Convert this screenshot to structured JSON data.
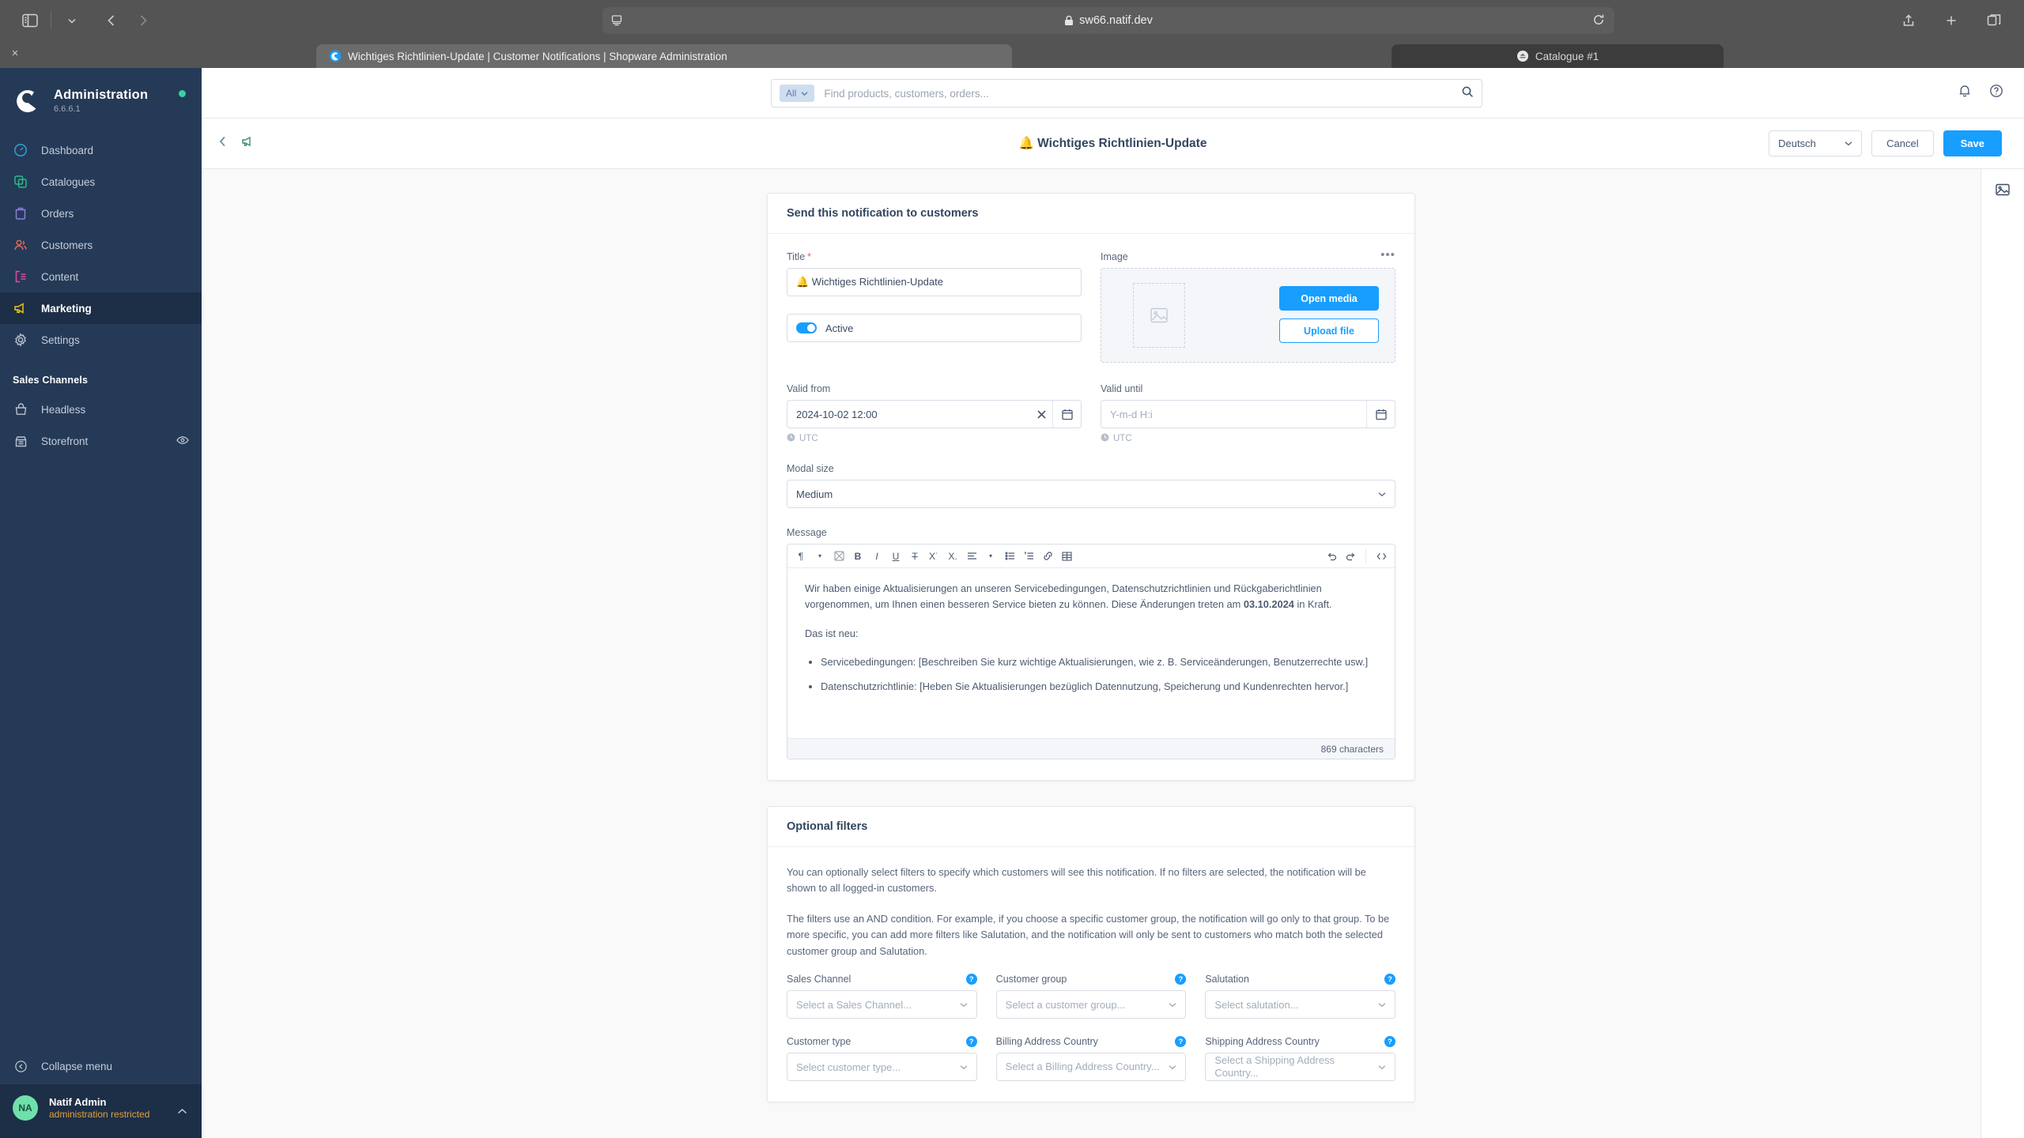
{
  "browser": {
    "url": "sw66.natif.dev",
    "lock_icon": "lock-icon",
    "reload_icon": "reload-icon",
    "back_icon": "back-arrow-icon",
    "forward_icon": "forward-arrow-icon",
    "sidebar_icon": "sidebar-toggle-icon",
    "screencast_icon": "screencast-icon",
    "share_icon": "share-icon",
    "new_tab_icon": "plus-icon",
    "tabs_overview_icon": "tabs-overview-icon",
    "close_all_label": "×",
    "tabs": [
      {
        "title": "Wichtiges Richtlinien-Update | Customer Notifications | Shopware Administration",
        "favicon": "shopware-favicon",
        "emoji": "🔔",
        "active": true
      },
      {
        "title": "Catalogue #1",
        "favicon": "catalogue-favicon",
        "active": false
      }
    ]
  },
  "sidebar": {
    "title": "Administration",
    "version": "6.6.6.1",
    "status_dot_color": "#37d39b",
    "items": [
      {
        "label": "Dashboard",
        "icon": "dashboard-icon",
        "color": "#31a0d4",
        "active": false
      },
      {
        "label": "Catalogues",
        "icon": "catalogues-icon",
        "color": "#2bb98a",
        "active": false
      },
      {
        "label": "Orders",
        "icon": "orders-icon",
        "color": "#8e7ee0",
        "active": false
      },
      {
        "label": "Customers",
        "icon": "customers-icon",
        "color": "#e06c5a",
        "active": false
      },
      {
        "label": "Content",
        "icon": "content-icon",
        "color": "#e34ba0",
        "active": false
      },
      {
        "label": "Marketing",
        "icon": "marketing-icon",
        "color": "#e8c51f",
        "active": true
      },
      {
        "label": "Settings",
        "icon": "settings-gear-icon",
        "color": "#b8c1cf",
        "active": false
      }
    ],
    "sales_channels_title": "Sales Channels",
    "sales_channels": [
      {
        "label": "Headless",
        "icon": "headless-icon",
        "has_eye": false
      },
      {
        "label": "Storefront",
        "icon": "storefront-icon",
        "has_eye": true
      }
    ],
    "collapse_label": "Collapse menu",
    "collapse_icon": "collapse-arrow-icon",
    "user": {
      "initials": "NA",
      "name": "Natif Admin",
      "role": "administration restricted",
      "caret_icon": "chevron-up-icon"
    }
  },
  "topbar": {
    "search_scope": "All",
    "search_scope_caret": "chevron-down-icon",
    "search_placeholder": "Find products, customers, orders...",
    "search_value": "",
    "search_icon": "search-icon",
    "notification_icon": "bell-icon",
    "help_icon": "help-circle-icon"
  },
  "page_header": {
    "back_icon": "chevron-left-icon",
    "notification_icon": "notification-megaphone-icon",
    "title": "🔔 Wichtiges Richtlinien-Update",
    "language": "Deutsch",
    "language_caret": "chevron-down-icon",
    "cancel_label": "Cancel",
    "save_label": "Save",
    "accent_color": "#189eff"
  },
  "notification_card": {
    "heading": "Send this notification to customers",
    "title_label": "Title",
    "title_required": "*",
    "title_value": "🔔 Wichtiges Richtlinien-Update",
    "active_label": "Active",
    "active_on": true,
    "image_label": "Image",
    "image_menu_icon": "ellipsis-icon",
    "image_placeholder_icon": "image-placeholder-icon",
    "open_media_label": "Open media",
    "upload_file_label": "Upload file",
    "valid_from_label": "Valid from",
    "valid_from_value": "2024-10-02 12:00",
    "valid_from_clear_icon": "clear-x-icon",
    "valid_from_calendar_icon": "calendar-icon",
    "valid_from_tz": "UTC",
    "valid_until_label": "Valid until",
    "valid_until_placeholder": "Y-m-d H:i",
    "valid_until_calendar_icon": "calendar-icon",
    "valid_until_tz": "UTC",
    "tz_clock_icon": "clock-icon",
    "modal_size_label": "Modal size",
    "modal_size_value": "Medium",
    "message_label": "Message",
    "toolbar_buttons": [
      "paragraph-format-icon",
      "chevron-down-icon",
      "color-picker-icon",
      "bold-icon",
      "italic-icon",
      "underline-icon",
      "strikethrough-icon",
      "superscript-icon",
      "subscript-icon",
      "align-icon",
      "chevron-down-icon",
      "indent-decrease-icon",
      "ordered-list-icon",
      "link-icon",
      "table-icon"
    ],
    "toolbar_right_buttons": [
      "undo-icon",
      "redo-icon",
      "source-code-icon"
    ],
    "message_paragraph_1_a": "Wir haben einige Aktualisierungen an unseren Servicebedingungen, Datenschutzrichtlinien und Rückgaberichtlinien vorgenommen, um Ihnen einen besseren Service bieten zu können. Diese Änderungen treten am ",
    "message_paragraph_1_bold": "03.10.2024",
    "message_paragraph_1_b": " in Kraft.",
    "message_paragraph_2": "Das ist neu:",
    "message_bullets": [
      "Servicebedingungen: [Beschreiben Sie kurz wichtige Aktualisierungen, wie z. B. Serviceänderungen, Benutzerrechte usw.]",
      "Datenschutzrichtlinie: [Heben Sie Aktualisierungen bezüglich Datennutzung, Speicherung und Kundenrechten hervor.]"
    ],
    "character_count": "869 characters"
  },
  "filters_card": {
    "heading": "Optional filters",
    "paragraph_1": "You can optionally select filters to specify which customers will see this notification. If no filters are selected, the notification will be shown to all logged-in customers.",
    "paragraph_2": "The filters use an AND condition. For example, if you choose a specific customer group, the notification will go only to that group. To be more specific, you can add more filters like Salutation, and the notification will only be sent to customers who match both the selected customer group and Salutation.",
    "help_badge_label": "?",
    "fields_row_1": [
      {
        "label": "Sales Channel",
        "placeholder": "Select a Sales Channel...",
        "value": ""
      },
      {
        "label": "Customer group",
        "placeholder": "Select a customer group...",
        "value": ""
      },
      {
        "label": "Salutation",
        "placeholder": "Select salutation...",
        "value": ""
      }
    ],
    "fields_row_2": [
      {
        "label": "Customer type",
        "placeholder": "Select customer type...",
        "value": ""
      },
      {
        "label": "Billing Address Country",
        "placeholder": "Select a Billing Address Country...",
        "value": ""
      },
      {
        "label": "Shipping Address Country",
        "placeholder": "Select a Shipping Address Country...",
        "value": ""
      }
    ]
  },
  "right_rail": {
    "media_icon": "media-sidebar-icon"
  }
}
